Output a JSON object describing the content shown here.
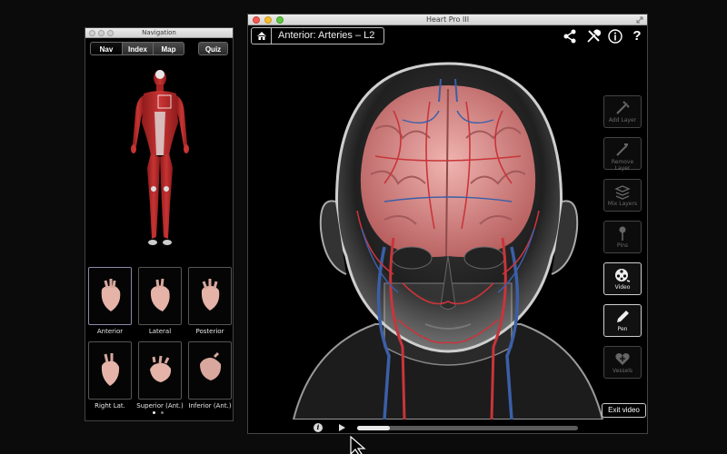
{
  "nav_window": {
    "title": "Navigation",
    "tabs": [
      {
        "label": "Nav",
        "active": true
      },
      {
        "label": "Index",
        "active": false
      },
      {
        "label": "Map",
        "active": false
      }
    ],
    "quiz_label": "Quiz",
    "views": [
      {
        "label": "Anterior",
        "selected": true
      },
      {
        "label": "Lateral",
        "selected": false
      },
      {
        "label": "Posterior",
        "selected": false
      },
      {
        "label": "Right Lat.",
        "selected": false
      },
      {
        "label": "Superior (Ant.)",
        "selected": false
      },
      {
        "label": "Inferior (Ant.)",
        "selected": false
      }
    ],
    "page_dots": {
      "count": 2,
      "current": 1
    }
  },
  "main_window": {
    "title": "Heart Pro III",
    "breadcrumb": {
      "home_icon": "home-icon",
      "view_title": "Anterior: Arteries – L2"
    },
    "top_icons": [
      "share-icon",
      "tools-icon",
      "info-icon",
      "help-icon"
    ],
    "help_glyph": "?",
    "tools": [
      {
        "label": "Add Layer",
        "icon": "add-layer-icon",
        "enabled": false
      },
      {
        "label": "Remove Layer",
        "icon": "remove-layer-icon",
        "enabled": false
      },
      {
        "label": "Mix Layers",
        "icon": "mix-layers-icon",
        "enabled": false
      },
      {
        "label": "Pins",
        "icon": "pin-icon",
        "enabled": false
      },
      {
        "label": "Video",
        "icon": "film-reel-icon",
        "enabled": true
      },
      {
        "label": "Pen",
        "icon": "pen-icon",
        "enabled": true
      },
      {
        "label": "Vessels",
        "icon": "heart-vessels-icon",
        "enabled": false
      }
    ],
    "exit_video_label": "Exit video",
    "video": {
      "info_glyph": "i",
      "progress": 0.15
    }
  },
  "colors": {
    "artery": "#c8353a",
    "vein": "#3b5fa8",
    "brain": "#d98e8c",
    "muscle": "#b82a2a",
    "close": "#f25a52",
    "minimize": "#f6bb2e",
    "maximize": "#5fc43f"
  }
}
